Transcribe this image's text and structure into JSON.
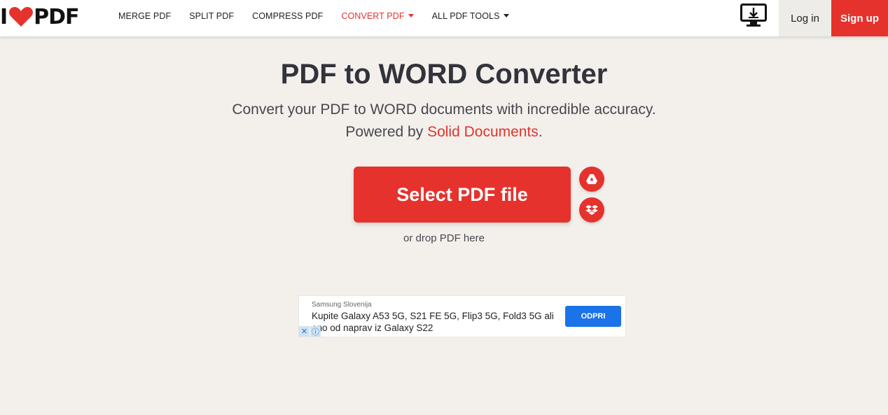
{
  "header": {
    "logo_left": "I",
    "logo_right": "PDF",
    "nav": [
      {
        "label": "MERGE PDF",
        "active": false,
        "dropdown": false
      },
      {
        "label": "SPLIT PDF",
        "active": false,
        "dropdown": false
      },
      {
        "label": "COMPRESS PDF",
        "active": false,
        "dropdown": false
      },
      {
        "label": "CONVERT PDF",
        "active": true,
        "dropdown": true
      },
      {
        "label": "ALL PDF TOOLS",
        "active": false,
        "dropdown": true
      }
    ],
    "desktop_icon": "desktop-download-icon",
    "login_label": "Log in",
    "signup_label": "Sign up"
  },
  "hero": {
    "title": "PDF to WORD Converter",
    "subtitle_line1": "Convert your PDF to WORD documents with incredible accuracy.",
    "subtitle_line2_prefix": "Powered by ",
    "subtitle_link": "Solid Documents",
    "subtitle_line2_suffix": ".",
    "select_label": "Select PDF file",
    "drop_text": "or drop PDF here",
    "cloud_icons": [
      "google-drive-icon",
      "dropbox-icon"
    ]
  },
  "ad": {
    "advertiser": "Samsung Slovenija",
    "text": "Kupite Galaxy A53 5G, S21 FE 5G, Flip3 5G, Fold3 5G ali eno od naprav iz Galaxy S22",
    "cta": "ODPRI",
    "close_glyph": "✕",
    "info_glyph": "ⓘ"
  },
  "colors": {
    "brand": "#e5322d",
    "background": "#f3f0ec",
    "ad_button": "#1a73e8"
  }
}
